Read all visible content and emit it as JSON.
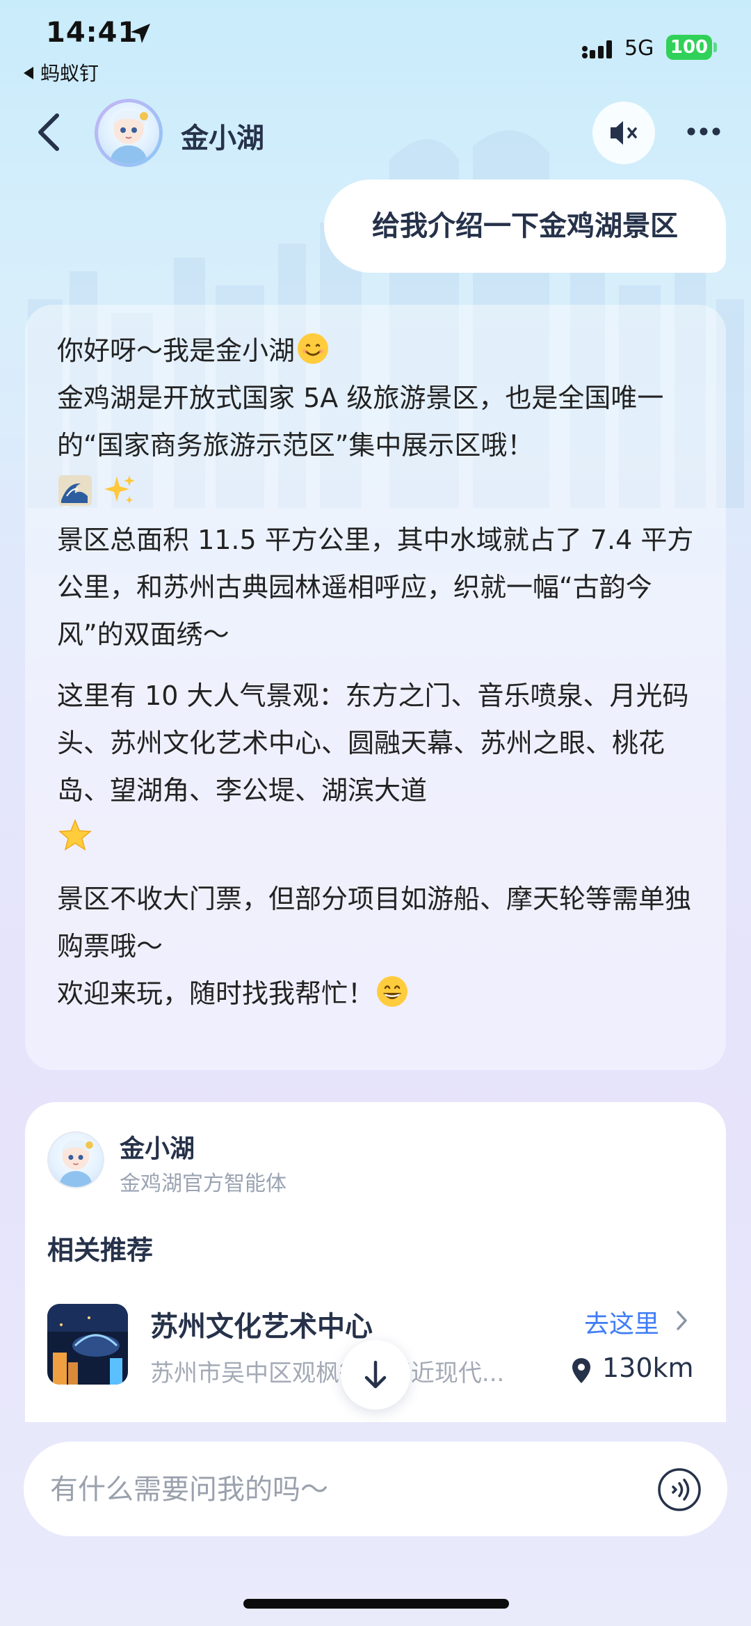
{
  "status_bar": {
    "time": "14:41",
    "back_app": "蚂蚁钉",
    "network": "5G",
    "battery": "100"
  },
  "header": {
    "name": "金小湖",
    "mute_icon": "speaker-mute-icon",
    "more_icon": "more-dots-icon"
  },
  "user_message": "给我介绍一下金鸡湖景区",
  "reply": {
    "line1": "你好呀～我是金小湖",
    "line2": "金鸡湖是开放式国家 5A 级旅游景区，也是全国唯一的“国家商务旅游示范区”集中展示区哦！",
    "line3": "景区总面积 11.5 平方公里，其中水域就占了 7.4 平方公里，和苏州古典园林遥相呼应，织就一幅“古韵今风”的双面绣～",
    "line4": "这里有 10 大人气景观：东方之门、音乐喷泉、月光码头、苏州文化艺术中心、圆融天幕、苏州之眼、桃花岛、望湖角、李公堤、湖滨大道",
    "line5": "景区不收大门票，但部分项目如游船、摩天轮等需单独购票哦～",
    "line6": "欢迎来玩，随时找我帮忙！"
  },
  "card": {
    "name": "金小湖",
    "subtitle": "金鸡湖官方智能体",
    "section_title": "相关推荐",
    "place": {
      "name": "苏州文化艺术中心",
      "address": "苏州市吴中区观枫街1号(近现代...",
      "action": "去这里",
      "distance": "130km"
    }
  },
  "input": {
    "placeholder": "有什么需要问我的吗～"
  },
  "colors": {
    "accent": "#3f7df6",
    "battery": "#30d158",
    "text_dark": "#26324a"
  }
}
